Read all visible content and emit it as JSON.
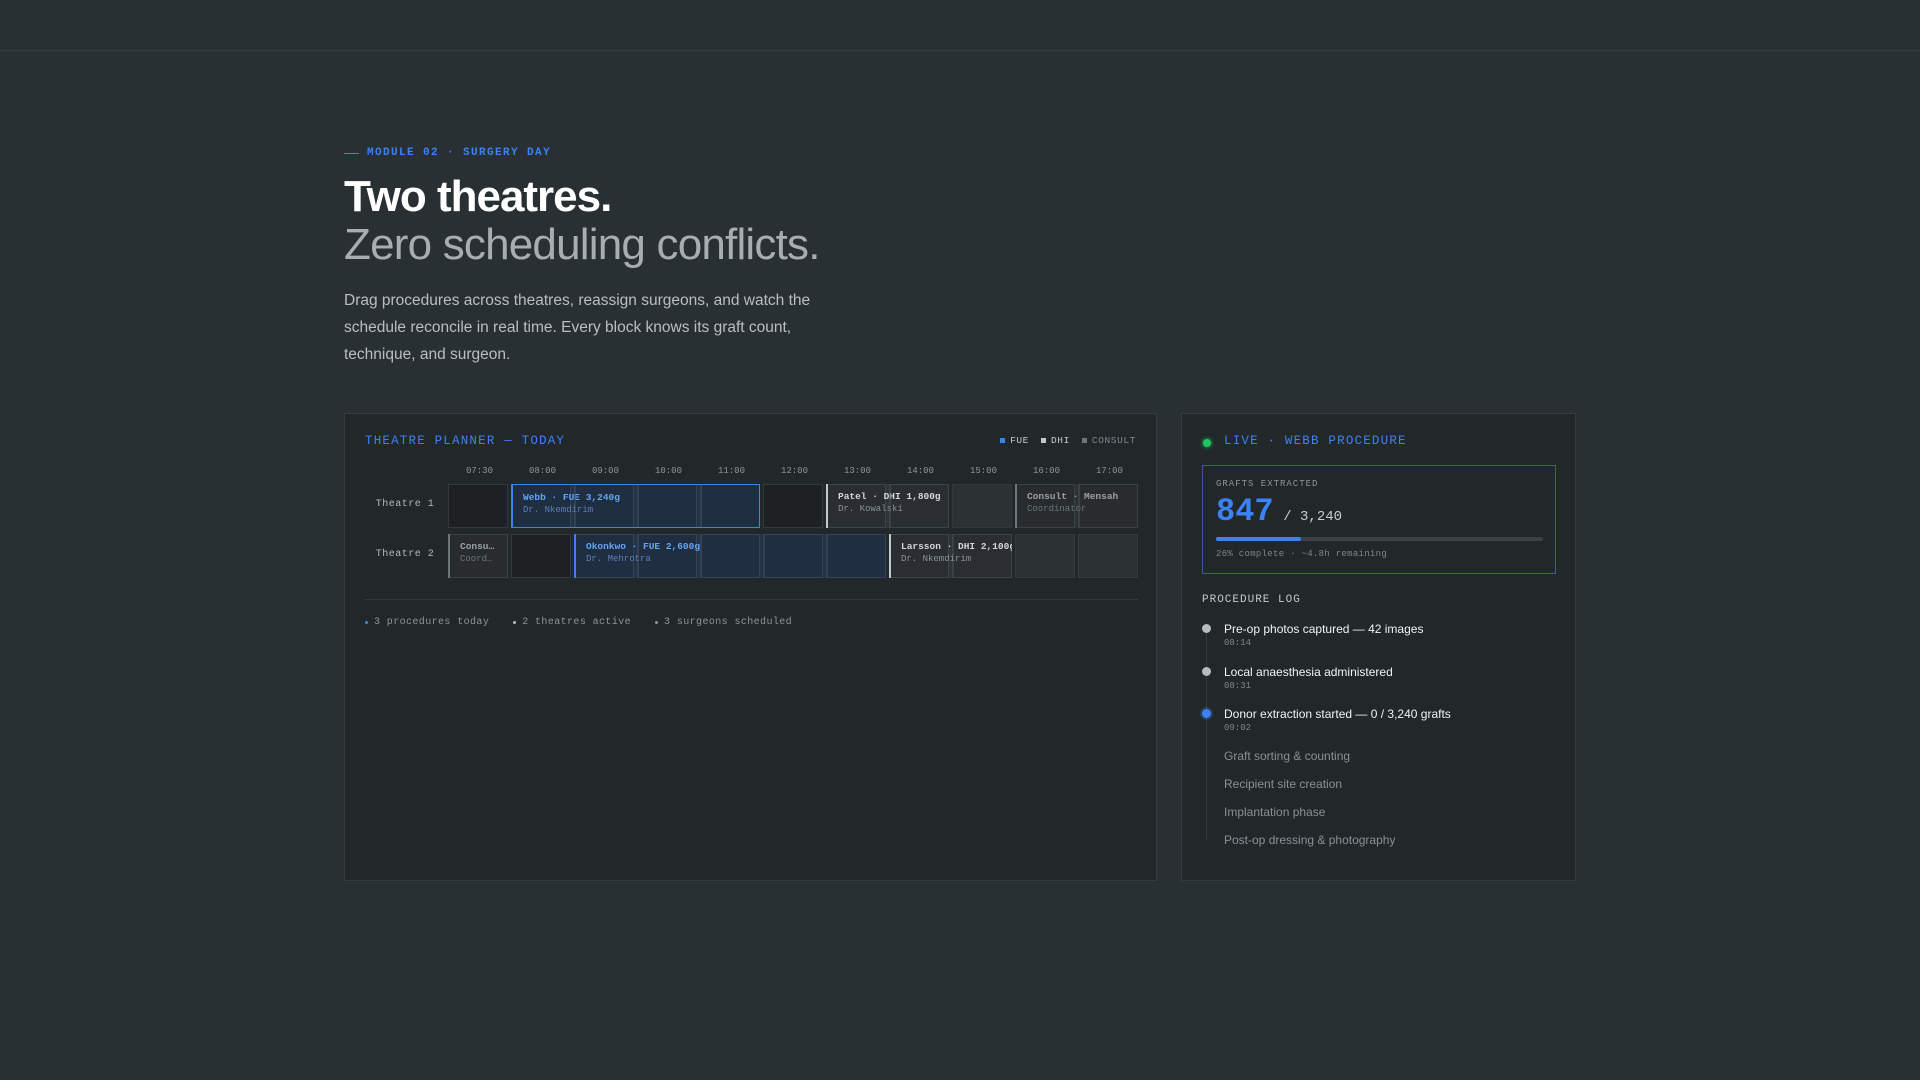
{
  "hero": {
    "eyebrow": "MODULE 02 · SURGERY DAY",
    "headline": "Two theatres.",
    "subheadline": "Zero scheduling conflicts.",
    "lede": "Drag procedures across theatres, reassign surgeons, and watch the schedule reconcile in real time. Every block knows its graft count, technique, and surgeon."
  },
  "planner": {
    "title": "THEATRE PLANNER — TODAY",
    "legend": [
      {
        "label": "FUE",
        "color": "#3b82f6"
      },
      {
        "label": "DHI",
        "color": "#c3c8cc"
      },
      {
        "label": "CONSULT",
        "color": "#6f767b"
      }
    ],
    "times": [
      "07:30",
      "08:00",
      "09:00",
      "10:00",
      "11:00",
      "12:00",
      "13:00",
      "14:00",
      "15:00",
      "16:00",
      "17:00"
    ],
    "rows": [
      {
        "label": "Theatre 1"
      },
      {
        "label": "Theatre 2"
      }
    ],
    "blocks": [
      {
        "row": 0,
        "start": 1,
        "span": 4,
        "type": "fue",
        "selected": true,
        "title": "Webb · FUE 3,240g",
        "subtitle": "Dr. Nkemdirim"
      },
      {
        "row": 0,
        "start": 6,
        "span": 2,
        "type": "dhi",
        "selected": false,
        "title": "Patel · DHI 1,800g",
        "subtitle": "Dr. Kowalski"
      },
      {
        "row": 0,
        "start": 9,
        "span": 2,
        "type": "consult",
        "selected": false,
        "title": "Consult · Mensah",
        "subtitle": "Coordinator"
      },
      {
        "row": 1,
        "start": 0,
        "span": 1,
        "type": "consult",
        "selected": false,
        "title": "Consu…",
        "subtitle": "Coord…"
      },
      {
        "row": 1,
        "start": 2,
        "span": 5,
        "type": "fue",
        "selected": false,
        "title": "Okonkwo · FUE 2,600g",
        "subtitle": "Dr. Mehrotra"
      },
      {
        "row": 1,
        "start": 7,
        "span": 2,
        "type": "dhi",
        "selected": false,
        "title": "Larsson · DHI 2,100g",
        "subtitle": "Dr. Nkemdirim"
      }
    ],
    "stats": [
      {
        "label": "3 procedures today",
        "color": "#3b82f6"
      },
      {
        "label": "2 theatres active",
        "color": "#b7bcc0"
      },
      {
        "label": "3 surgeons scheduled",
        "color": "#8e9499"
      }
    ]
  },
  "live": {
    "title": "LIVE · WEBB PROCEDURE",
    "grafts_label": "GRAFTS EXTRACTED",
    "grafts_done": "847",
    "grafts_total": "/ 3,240",
    "progress_fraction": 0.26,
    "progress_text": "26% complete · ~4.8h remaining",
    "log_title": "PROCEDURE LOG",
    "log": [
      {
        "text": "Pre-op photos captured — 42 images",
        "time": "08:14",
        "state": "done"
      },
      {
        "text": "Local anaesthesia administered",
        "time": "08:31",
        "state": "done"
      },
      {
        "text": "Donor extraction started — 0 / 3,240 grafts",
        "time": "09:02",
        "state": "active"
      },
      {
        "text": "Graft sorting & counting",
        "time": "",
        "state": "pending"
      },
      {
        "text": "Recipient site creation",
        "time": "",
        "state": "pending"
      },
      {
        "text": "Implantation phase",
        "time": "",
        "state": "pending"
      },
      {
        "text": "Post-op dressing & photography",
        "time": "",
        "state": "pending"
      }
    ]
  }
}
